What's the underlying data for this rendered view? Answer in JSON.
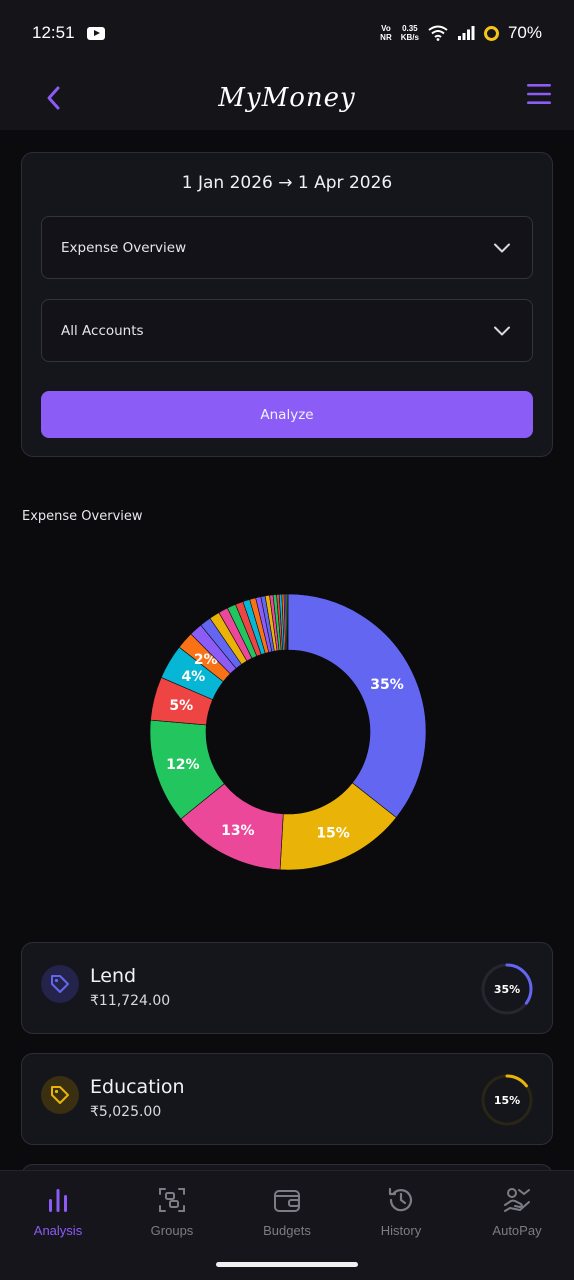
{
  "status_bar": {
    "time": "12:51",
    "net_type_top": "Vo",
    "net_type_bottom": "NR",
    "speed_value": "0.35",
    "speed_unit": "KB/s",
    "battery": "70%"
  },
  "app_bar": {
    "title": "MyMoney",
    "back_icon": "chevron-left-icon",
    "menu_icon": "hamburger-menu-icon"
  },
  "filters": {
    "date_range": "1 Jan 2026 → 1 Apr 2026",
    "report_type": "Expense Overview",
    "account": "All Accounts",
    "analyze_label": "Analyze",
    "accent": "#8b5cf6"
  },
  "chart_section": {
    "title": "Expense Overview"
  },
  "chart_data": {
    "type": "pie",
    "slices": [
      {
        "label": "35%",
        "value": 35,
        "color": "#6366f1"
      },
      {
        "label": "15%",
        "value": 15,
        "color": "#eab308"
      },
      {
        "label": "13%",
        "value": 13,
        "color": "#ec4899"
      },
      {
        "label": "12%",
        "value": 12,
        "color": "#22c55e"
      },
      {
        "label": "5%",
        "value": 5,
        "color": "#ef4444"
      },
      {
        "label": "4%",
        "value": 4,
        "color": "#06b6d4"
      },
      {
        "label": "2%",
        "value": 2,
        "color": "#f97316"
      },
      {
        "label": "",
        "value": 1.5,
        "color": "#8b5cf6"
      },
      {
        "label": "",
        "value": 1.3,
        "color": "#6366f1"
      },
      {
        "label": "",
        "value": 1.2,
        "color": "#eab308"
      },
      {
        "label": "",
        "value": 1.1,
        "color": "#ec4899"
      },
      {
        "label": "",
        "value": 1.0,
        "color": "#22c55e"
      },
      {
        "label": "",
        "value": 0.9,
        "color": "#ef4444"
      },
      {
        "label": "",
        "value": 0.8,
        "color": "#06b6d4"
      },
      {
        "label": "",
        "value": 0.7,
        "color": "#f97316"
      },
      {
        "label": "",
        "value": 0.6,
        "color": "#8b5cf6"
      },
      {
        "label": "",
        "value": 0.5,
        "color": "#6366f1"
      },
      {
        "label": "",
        "value": 0.5,
        "color": "#eab308"
      },
      {
        "label": "",
        "value": 0.4,
        "color": "#ec4899"
      },
      {
        "label": "",
        "value": 0.4,
        "color": "#22c55e"
      },
      {
        "label": "",
        "value": 0.3,
        "color": "#ef4444"
      },
      {
        "label": "",
        "value": 0.3,
        "color": "#06b6d4"
      },
      {
        "label": "",
        "value": 0.25,
        "color": "#f97316"
      },
      {
        "label": "",
        "value": 0.2,
        "color": "#8b5cf6"
      },
      {
        "label": "",
        "value": 0.15,
        "color": "#22c55e"
      },
      {
        "label": "",
        "value": 0.1,
        "color": "#eab308"
      }
    ]
  },
  "categories": [
    {
      "name": "Lend",
      "amount": "₹11,724.00",
      "percent_label": "35%",
      "percent": 35,
      "color": "#6366f1",
      "icon": "tag-icon"
    },
    {
      "name": "Education",
      "amount": "₹5,025.00",
      "percent_label": "15%",
      "percent": 15,
      "color": "#eab308",
      "icon": "tag-icon"
    }
  ],
  "bottom_nav": {
    "items": [
      {
        "label": "Analysis",
        "icon": "bar-chart-icon",
        "active": true
      },
      {
        "label": "Groups",
        "icon": "groups-scan-icon",
        "active": false
      },
      {
        "label": "Budgets",
        "icon": "wallet-icon",
        "active": false
      },
      {
        "label": "History",
        "icon": "history-icon",
        "active": false
      },
      {
        "label": "AutoPay",
        "icon": "autopay-hand-icon",
        "active": false
      }
    ]
  }
}
